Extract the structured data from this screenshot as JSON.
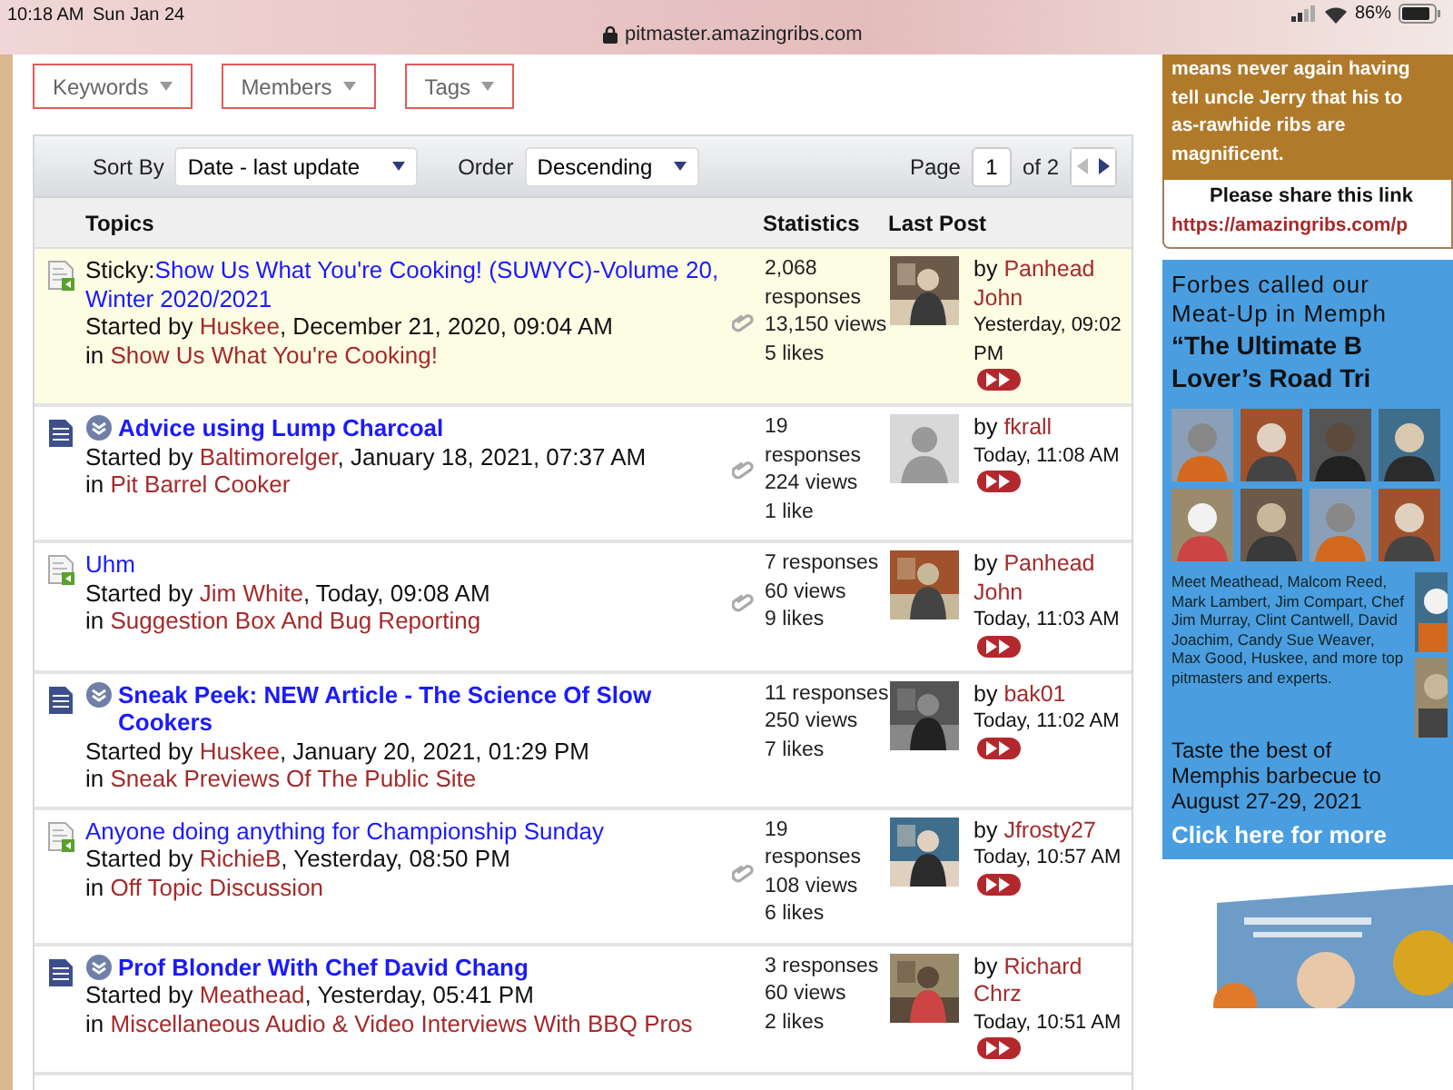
{
  "status_bar": {
    "time": "10:18 AM",
    "date": "Sun Jan 24",
    "url": "pitmaster.amazingribs.com",
    "battery": "86%"
  },
  "filters": [
    "Keywords",
    "Members",
    "Tags"
  ],
  "toolbar": {
    "sort_label": "Sort By",
    "sort_value": "Date - last update",
    "order_label": "Order",
    "order_value": "Descending",
    "page_label": "Page",
    "page": "1",
    "page_total": "of 2"
  },
  "table": {
    "columns": [
      "Topics",
      "Statistics",
      "Last Post"
    ],
    "rows": [
      {
        "kind": "new",
        "important": false,
        "sticky": true,
        "prefix": "Sticky:",
        "title": "Show Us What You're Cooking! (SUWYC)-Volume 20, Winter 2020/2021",
        "started_label": "Started by",
        "author": "Huskee",
        "started": ", December 21, 2020, 09:04 AM",
        "in_label": "in",
        "board": "Show Us What You're Cooking!",
        "attachment": true,
        "responses": "2,068 responses",
        "views": "13,150 views",
        "likes": "5 likes",
        "by_label": "by",
        "by": "Panhead John",
        "last_date": "Yesterday, 09:02 PM"
      },
      {
        "kind": "article",
        "important": true,
        "sticky": false,
        "title": "Advice using Lump Charcoal",
        "started_label": "Started by",
        "author": "Baltimorelger",
        "started": ", January 18, 2021, 07:37 AM",
        "in_label": "in",
        "board": "Pit Barrel Cooker",
        "attachment": true,
        "responses": "19 responses",
        "views": "224 views",
        "likes": "1 like",
        "avatar": {
          "kind": "default"
        },
        "by_label": "by",
        "by": "fkrall",
        "last_date": "Today, 11:08 AM"
      },
      {
        "kind": "new",
        "important": false,
        "sticky": false,
        "title": "Uhm",
        "started_label": "Started by",
        "author": "Jim White",
        "started": ", Today, 09:08 AM",
        "in_label": "in",
        "board": "Suggestion Box And Bug Reporting",
        "attachment": true,
        "responses": "7 responses",
        "views": "60 views",
        "likes": "9 likes",
        "by_label": "by",
        "by": "Panhead John",
        "last_date": "Today, 11:03 AM"
      },
      {
        "kind": "article",
        "important": true,
        "sticky": false,
        "title": "Sneak Peek: NEW Article - The Science Of Slow Cookers",
        "started_label": "Started by",
        "author": "Huskee",
        "started": ", January 20, 2021, 01:29 PM",
        "in_label": "in",
        "board": "Sneak Previews Of The Public Site",
        "attachment": false,
        "responses": "11 responses",
        "views": "250 views",
        "likes": "7 likes",
        "by_label": "by",
        "by": "bak01",
        "last_date": "Today, 11:02 AM"
      },
      {
        "kind": "new",
        "important": false,
        "sticky": false,
        "title": "Anyone doing anything for Championship Sunday",
        "started_label": "Started by",
        "author": "RichieB",
        "started": ", Yesterday, 08:50 PM",
        "in_label": "in",
        "board": "Off Topic Discussion",
        "attachment": true,
        "responses": "19 responses",
        "views": "108 views",
        "likes": "6 likes",
        "by_label": "by",
        "by": "Jfrosty27",
        "last_date": "Today, 10:57 AM"
      },
      {
        "kind": "article",
        "important": true,
        "sticky": false,
        "title": "Prof Blonder With Chef David Chang",
        "started_label": "Started by",
        "author": "Meathead",
        "started": ", Yesterday, 05:41 PM",
        "in_label": "in",
        "board": "Miscellaneous Audio & Video Interviews With BBQ Pros",
        "attachment": false,
        "responses": "3 responses",
        "views": "60 views",
        "likes": "2 likes",
        "by_label": "by",
        "by": "Richard Chrz",
        "last_date": "Today, 10:51 AM"
      }
    ]
  },
  "sidebar": {
    "promo_lines": [
      "means never again having",
      "tell uncle Jerry that his to",
      "as-rawhide ribs are",
      "magnificent."
    ],
    "share_label": "Please share this link",
    "share_link": "https://amazingribs.com/p",
    "ad": {
      "intro": [
        "Forbes called our",
        "Meat-Up in Memph"
      ],
      "headline": [
        "“The Ultimate B",
        "Lover’s Road Tri"
      ],
      "body": "Meet Meathead, Malcom Reed, Mark Lambert, Jim Compart, Chef Jim Murray, Clint Cantwell, David Joachim, Candy Sue Weaver, Max Good, Huskee, and more top pitmasters and experts.",
      "tagline": [
        "Taste the best of",
        "Memphis barbecue to",
        "August 27-29, 2021"
      ],
      "cta": "Click here for more"
    }
  }
}
